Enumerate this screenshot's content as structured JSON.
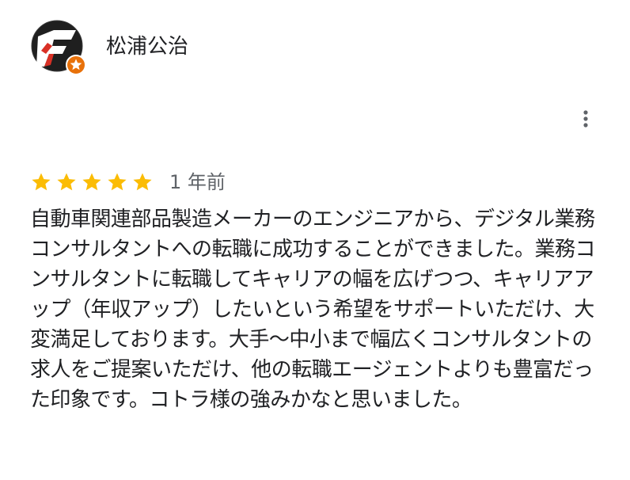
{
  "reviewer": {
    "name": "松浦公治",
    "avatar_icon": "reviewer-logo-avatar",
    "badge_icon": "local-guide-star-badge",
    "badge_color": "#e8710a"
  },
  "menu": {
    "icon": "more-vert-icon"
  },
  "rating": {
    "stars": 5,
    "max_stars": 5,
    "star_color": "#fbbc04",
    "date": "1 年前"
  },
  "review": {
    "text": "自動車関連部品製造メーカーのエンジニアから、デジタル業務コンサルタントへの転職に成功することができました。業務コンサルタントに転職してキャリアの幅を広げつつ、キャリアアップ（年収アップ）したいという希望をサポートいただけ、大変満足しております。大手〜中小まで幅広くコンサルタントの求人をご提案いただけ、他の転職エージェントよりも豊富だった印象です。コトラ様の強みかなと思いました。"
  }
}
